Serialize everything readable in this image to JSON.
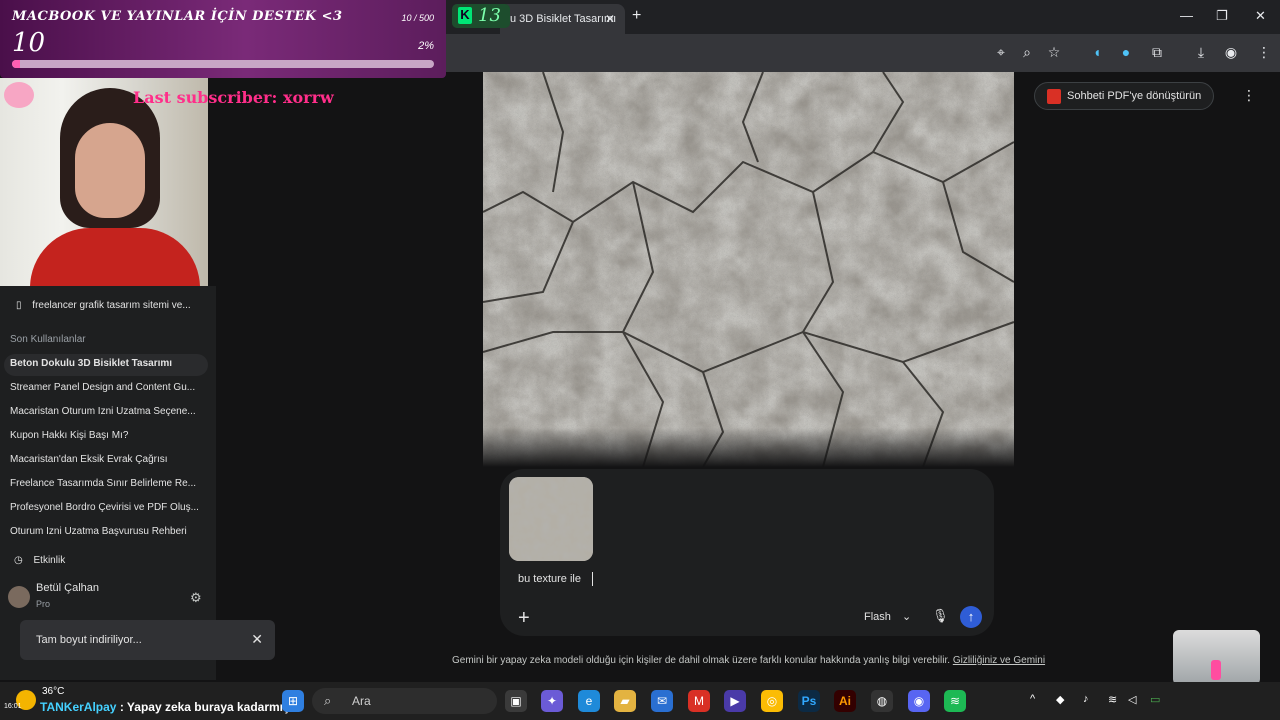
{
  "overlay": {
    "donation_title": "MACBOOK VE YAYINLAR İÇİN DESTEK <3",
    "donation_count": "10 / 500",
    "donation_amount": "10",
    "donation_percent_label": "2%",
    "donation_progress": 0.02,
    "kick_viewers": "13",
    "last_subscriber": "Last subscriber: xorrw"
  },
  "browser": {
    "tab_title": "u 3D Bisiklet Tasarımı",
    "icons": [
      "location-icon",
      "zoom-icon",
      "star-icon",
      "extensions-icon",
      "download-icon",
      "profile-avatar",
      "menu-icon"
    ]
  },
  "sidebar": {
    "gem_item": "freelancer grafik tasarım sitemi ve...",
    "recent_heading": "Son Kullanılanlar",
    "recent": [
      "Beton Dokulu 3D Bisiklet Tasarımı",
      "Streamer Panel Design and Content Gu...",
      "Macaristan Oturum İzni Uzatma Seçene...",
      "Kupon Hakkı Kişi Başı Mı?",
      "Macaristan'dan Eksik Evrak Çağrısı",
      "Freelance Tasarımda Sınır Belirleme Re...",
      "Profesyonel Bordro Çevirisi ve PDF Oluş...",
      "Oturum İzni Uzatma Başvurusu Rehberi"
    ],
    "activity": "Etkinlik",
    "user_name": "Betül Çalhan",
    "user_plan": "Pro"
  },
  "main": {
    "pdf_button": "Sohbeti PDF'ye dönüştürün",
    "prompt_text": "bu texture ile",
    "model": "Flash",
    "disclaimer": "Gemini bir yapay zeka modeli olduğu için kişiler de dahil olmak üzere farklı konular hakkında yanlış bilgi verebilir.",
    "disclaimer_link": "Gizliliğiniz ve Gemini"
  },
  "toast": {
    "text": "Tam boyut indiriliyor..."
  },
  "taskbar": {
    "temperature": "36°C",
    "search_label": "Ara",
    "chat_nick": "TANKerAlpay",
    "chat_message": ": Yapay zeka buraya kadarmış",
    "clock": "16:01"
  }
}
